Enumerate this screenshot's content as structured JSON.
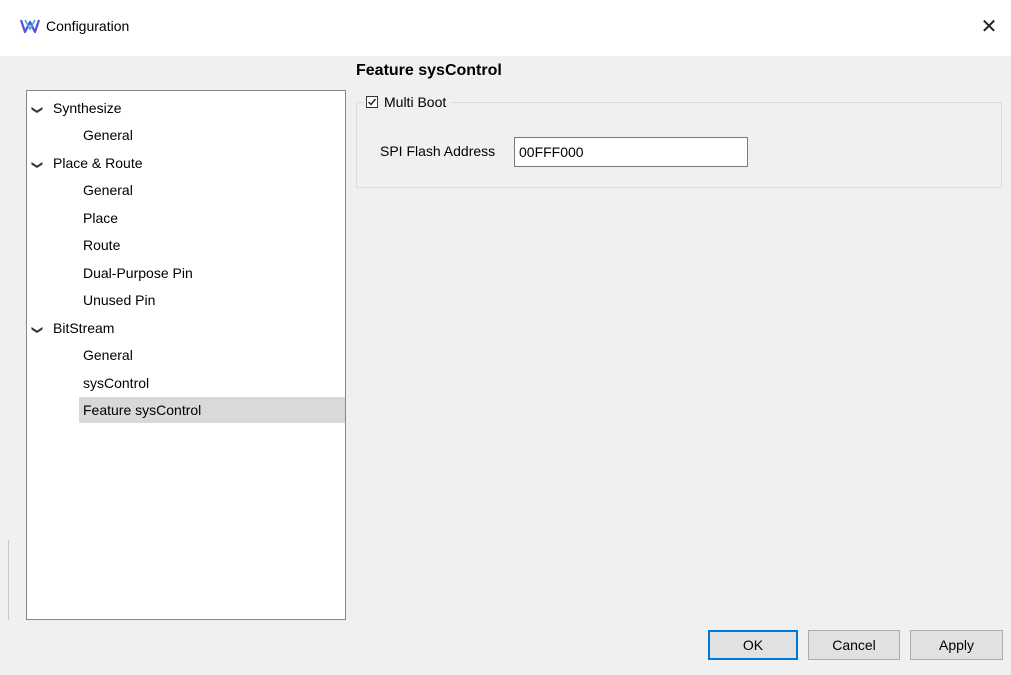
{
  "window": {
    "title": "Configuration",
    "close_glyph": "✕",
    "app_icon": "gowin-logo-icon"
  },
  "tree": {
    "items": [
      {
        "label": "Synthesize",
        "level": 0,
        "expanded": true
      },
      {
        "label": "General",
        "level": 1
      },
      {
        "label": "Place & Route",
        "level": 0,
        "expanded": true
      },
      {
        "label": "General",
        "level": 1
      },
      {
        "label": "Place",
        "level": 1
      },
      {
        "label": "Route",
        "level": 1
      },
      {
        "label": "Dual-Purpose Pin",
        "level": 1
      },
      {
        "label": "Unused Pin",
        "level": 1
      },
      {
        "label": "BitStream",
        "level": 0,
        "expanded": true
      },
      {
        "label": "General",
        "level": 1
      },
      {
        "label": "sysControl",
        "level": 1
      },
      {
        "label": "Feature sysControl",
        "level": 1,
        "selected": true
      }
    ]
  },
  "panel": {
    "title": "Feature sysControl",
    "multi_boot": {
      "label": "Multi Boot",
      "checked": true
    },
    "spi_flash": {
      "label": "SPI Flash Address",
      "value": "00FFF000"
    }
  },
  "buttons": {
    "ok": "OK",
    "cancel": "Cancel",
    "apply": "Apply"
  },
  "colors": {
    "accent": "#0078d7",
    "selection": "#d9d9d9",
    "logo": "#5b4fd6"
  }
}
